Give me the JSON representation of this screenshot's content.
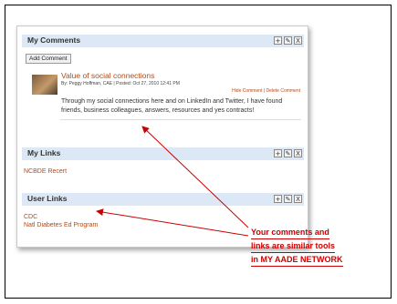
{
  "my_comments": {
    "title": "My Comments",
    "add_button": "Add Comment",
    "comment": {
      "title": "Value of social connections",
      "meta": "By: Peggy Hoffman, CAE | Posted: Oct 27, 2010 12:41 PM",
      "actions": "Hide Comment | Delete Comment",
      "body": "Through my social connections here and on LinkedIn and Twitter, I have found friends, business colleagues, answers, resources and yes contracts!"
    }
  },
  "my_links": {
    "title": "My Links",
    "items": [
      "NCBDE Recert"
    ]
  },
  "user_links": {
    "title": "User Links",
    "items": [
      "CDC",
      "Natl Diabetes Ed Program"
    ]
  },
  "controls": {
    "add": "+",
    "edit": "✎",
    "close": "X"
  },
  "callout": {
    "lines": [
      "Your comments and",
      "links are similar tools",
      "in MY AADE NETWORK"
    ]
  },
  "colors": {
    "annotation": "#cc0000",
    "link": "#b04a18",
    "header_bg": "#dce8f5"
  }
}
